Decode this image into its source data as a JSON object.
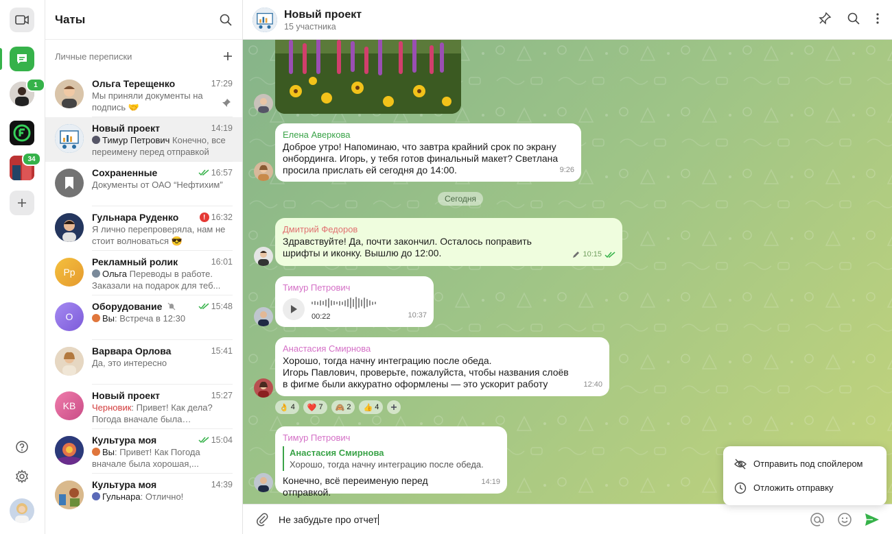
{
  "sidebar": {
    "rail": {
      "badge_1": "1",
      "badge_2": "34"
    },
    "header": {
      "title": "Чаты"
    },
    "section_title": "Личные переписки",
    "chats": [
      {
        "name": "Ольга Терещенко",
        "time": "17:29",
        "preview": "Мы приняли документы на подпись 🤝",
        "pinned": true
      },
      {
        "name": "Новый проект",
        "time": "14:19",
        "who": "Тимур Петрович",
        "preview": "Конечно, все переимену перед отправкой"
      },
      {
        "name": "Сохраненные",
        "time": "16:57",
        "preview": "Документы от ОАО “Нефтихим”",
        "read": true
      },
      {
        "name": "Гульнара Руденко",
        "time": "16:32",
        "preview": "Я лично перепроверяла, нам не стоит волноваться 😎",
        "alert": "!"
      },
      {
        "name": "Рекламный ролик",
        "time": "16:01",
        "initials": "Рр",
        "who": "Ольга",
        "preview": "Переводы в работе. Заказали на подарок для теб..."
      },
      {
        "name": "Оборудование",
        "time": "15:48",
        "initials": "О",
        "who": "Вы",
        "preview": "Встреча в 12:30",
        "read": true,
        "muted": true
      },
      {
        "name": "Варвара Орлова",
        "time": "15:41",
        "preview": "Да, это интересно"
      },
      {
        "name": "Новый проект",
        "time": "15:27",
        "initials": "KB",
        "draft": "Черновик",
        "preview": "Привет! Как дела? Погода вначале была хорошая,..."
      },
      {
        "name": "Культура моя",
        "time": "15:04",
        "who": "Вы",
        "preview": "Привет! Как Погода вначале была хорошая,...",
        "read": true
      },
      {
        "name": "Культура моя",
        "time": "14:39",
        "who": "Гульнара",
        "preview": "Отлично!"
      }
    ]
  },
  "chat": {
    "title": "Новый проект",
    "subtitle": "15 участника",
    "day_separator": "Сегодня",
    "messages": [
      {
        "sender": "Елена Аверкова",
        "text": "Доброе утро! Напоминаю, что завтра крайний срок по экрану онбординга. Игорь, у тебя готов финальный макет? Светлана просила прислать ей сегодня до 14:00.",
        "time": "9:26",
        "color": "#3aa348"
      },
      {
        "sender": "Дмитрий Федоров",
        "text": "Здравствуйте! Да, почти закончил. Осталось поправить шрифты и иконку. Вышлю до 12:00.",
        "time": "10:15",
        "color": "#e07070"
      },
      {
        "sender": "Тимур Петрович",
        "voice_duration": "00:22",
        "time": "10:37",
        "color": "#d46fc6"
      },
      {
        "sender": "Анастасия Смирнова",
        "text1": "Хорошо, тогда начну интеграцию после обеда.",
        "text2": "Игорь Павлович, проверьте, пожалуйста, чтобы названия слоёв в фигме были аккуратно оформлены — это ускорит работу",
        "time": "12:40",
        "color": "#d46fc6"
      },
      {
        "sender": "Тимур Петрович",
        "quote_sender": "Анастасия Смирнова",
        "quote_text": "Хорошо, тогда начну интеграцию после обеда.",
        "text": "Конечно, всё переименую перед отправкой.",
        "time": "14:19",
        "color": "#d46fc6"
      }
    ],
    "reactions": [
      {
        "emoji": "👌",
        "count": "4"
      },
      {
        "emoji": "❤️",
        "count": "7"
      },
      {
        "emoji": "🙈",
        "count": "2"
      },
      {
        "emoji": "👍",
        "count": "4"
      }
    ],
    "composer": {
      "text": "Не забудьте про отчет"
    },
    "context_menu": {
      "item1": "Отправить под спойлером",
      "item2": "Отложить отправку"
    }
  }
}
